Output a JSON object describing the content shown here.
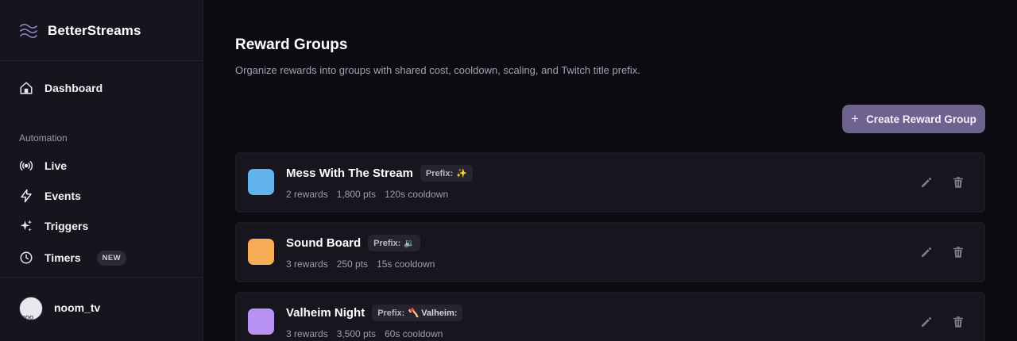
{
  "app": {
    "name": "BetterStreams"
  },
  "sidebar": {
    "dashboard_label": "Dashboard",
    "section_label": "Automation",
    "items": [
      {
        "label": "Live",
        "icon": "broadcast-icon"
      },
      {
        "label": "Events",
        "icon": "lightning-icon"
      },
      {
        "label": "Triggers",
        "icon": "sparkles-icon"
      },
      {
        "label": "Timers",
        "icon": "clock-icon",
        "badge": "NEW"
      }
    ],
    "user": {
      "name": "noom_tv",
      "avatar_alt": "noo"
    }
  },
  "page": {
    "title": "Reward Groups",
    "subtitle": "Organize rewards into groups with shared cost, cooldown, scaling, and Twitch title prefix.",
    "create_button": "Create Reward Group"
  },
  "groups": [
    {
      "name": "Mess With The Stream",
      "color": "#63b3ed",
      "prefix_label": "Prefix:",
      "prefix": "✨",
      "rewards": "2 rewards",
      "points": "1,800 pts",
      "cooldown": "120s cooldown"
    },
    {
      "name": "Sound Board",
      "color": "#f6ad55",
      "prefix_label": "Prefix:",
      "prefix": "🔉",
      "rewards": "3 rewards",
      "points": "250 pts",
      "cooldown": "15s cooldown"
    },
    {
      "name": "Valheim Night",
      "color": "#b794f4",
      "prefix_label": "Prefix:",
      "prefix": "🪓 Valheim:",
      "rewards": "3 rewards",
      "points": "3,500 pts",
      "cooldown": "60s cooldown"
    }
  ],
  "colors": {
    "accent": "#6e628f",
    "sidebar_bg": "#16151d",
    "page_bg": "#0c0b11",
    "card_bg": "#17161e"
  }
}
